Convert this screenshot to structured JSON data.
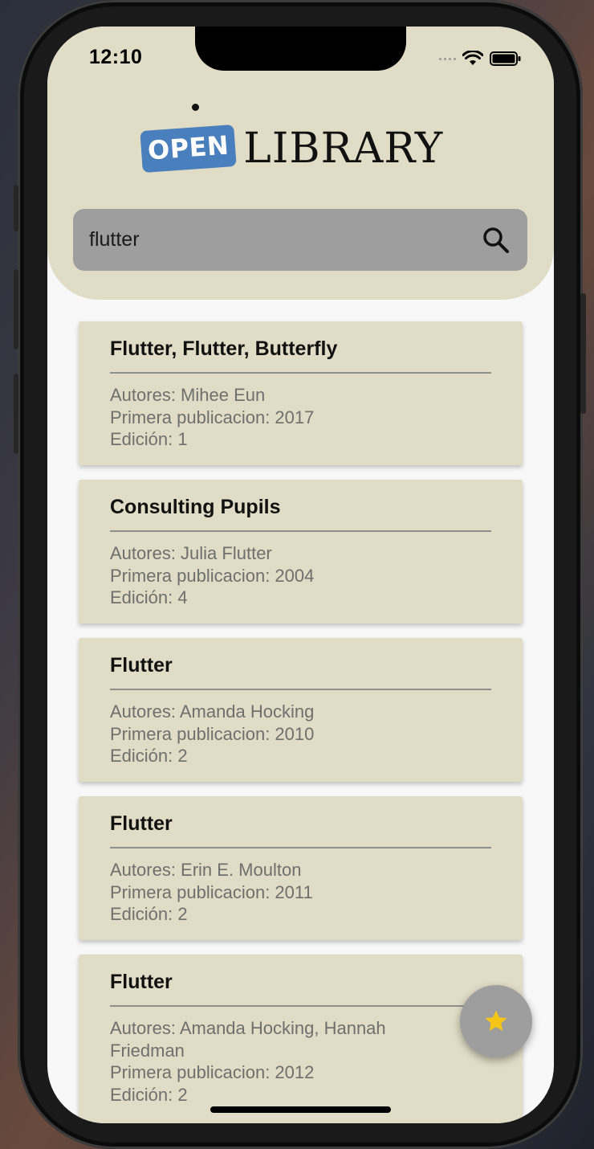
{
  "status_bar": {
    "time": "12:10"
  },
  "header": {
    "logo_badge": "OPEN",
    "logo_text": "LIBRARY"
  },
  "search": {
    "value": "flutter",
    "placeholder": ""
  },
  "results": [
    {
      "title": "Flutter, Flutter, Butterfly",
      "authors": "Autores: Mihee Eun",
      "first_publication": "Primera publicacion: 2017",
      "edition": "Edición: 1"
    },
    {
      "title": "Consulting Pupils",
      "authors": "Autores: Julia Flutter",
      "first_publication": "Primera publicacion: 2004",
      "edition": "Edición: 4"
    },
    {
      "title": "Flutter",
      "authors": "Autores: Amanda Hocking",
      "first_publication": "Primera publicacion: 2010",
      "edition": "Edición: 2"
    },
    {
      "title": "Flutter",
      "authors": "Autores: Erin E. Moulton",
      "first_publication": "Primera publicacion: 2011",
      "edition": "Edición: 2"
    },
    {
      "title": "Flutter",
      "authors": "Autores: Amanda Hocking, Hannah Friedman",
      "first_publication": "Primera publicacion: 2012",
      "edition": "Edición: 2"
    }
  ],
  "fab": {
    "icon": "star-icon"
  },
  "colors": {
    "header_bg": "#e0dcc6",
    "card_bg": "#e0dcc6",
    "search_bg": "#9e9e9e",
    "logo_badge_bg": "#4a7fbd",
    "star": "#f5c518",
    "fab_bg": "#9e9e9e"
  }
}
